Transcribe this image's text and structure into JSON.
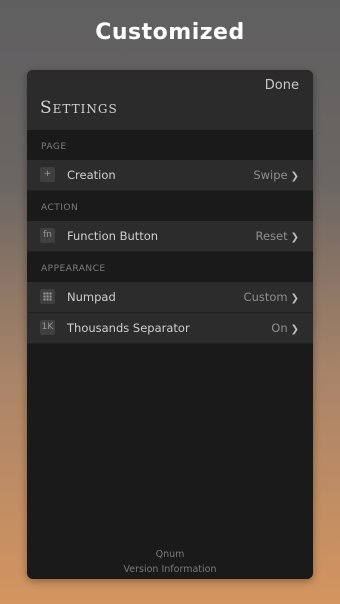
{
  "headline": "Customized",
  "header": {
    "done_label": "Done",
    "title": "Settings"
  },
  "sections": {
    "page": {
      "label": "PAGE",
      "rows": [
        {
          "icon": "plus-icon",
          "glyph": "+",
          "label": "Creation",
          "value": "Swipe"
        }
      ]
    },
    "action": {
      "label": "ACTION",
      "rows": [
        {
          "icon": "fn-icon",
          "glyph": "fn",
          "label": "Function Button",
          "value": "Reset"
        }
      ]
    },
    "appearance": {
      "label": "APPEARANCE",
      "rows": [
        {
          "icon": "numpad-grid-icon",
          "glyph": "",
          "label": "Numpad",
          "value": "Custom"
        },
        {
          "icon": "thousands-icon",
          "glyph": "1K",
          "label": "Thousands Separator",
          "value": "On"
        }
      ]
    }
  },
  "chevron": "❯",
  "footer": {
    "app_name": "Qnum",
    "version_link": "Version Information"
  }
}
